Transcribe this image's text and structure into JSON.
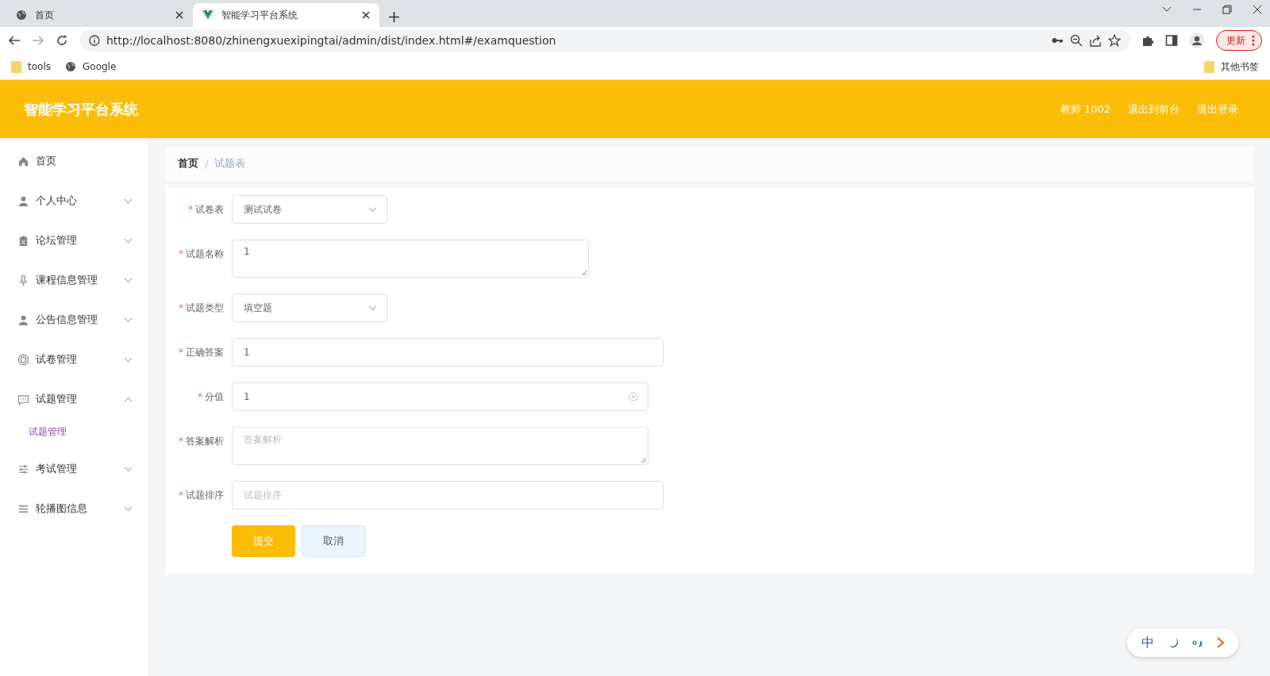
{
  "browser": {
    "tabs": [
      {
        "title": "首页",
        "selected": false
      },
      {
        "title": "智能学习平台系统",
        "selected": true
      }
    ],
    "url": "http://localhost:8080/zhinengxuexipingtai/admin/dist/index.html#/examquestion",
    "update_button": "更新",
    "bookmarks": [
      "tools",
      "Google"
    ],
    "other_bookmarks": "其他书签"
  },
  "header": {
    "title": "智能学习平台系统",
    "links": [
      "教师 1002",
      "退出到前台",
      "退出登录"
    ]
  },
  "sidebar": {
    "items": [
      {
        "label": "首页",
        "kind": "link"
      },
      {
        "label": "个人中心",
        "kind": "menu",
        "expanded": false
      },
      {
        "label": "论坛管理",
        "kind": "menu",
        "expanded": false
      },
      {
        "label": "课程信息管理",
        "kind": "menu",
        "expanded": false
      },
      {
        "label": "公告信息管理",
        "kind": "menu",
        "expanded": false
      },
      {
        "label": "试卷管理",
        "kind": "menu",
        "expanded": false
      },
      {
        "label": "试题管理",
        "kind": "menu",
        "expanded": true,
        "children": [
          {
            "label": "试题管理",
            "selected": true
          }
        ]
      },
      {
        "label": "考试管理",
        "kind": "menu",
        "expanded": false
      },
      {
        "label": "轮播图信息",
        "kind": "menu",
        "expanded": false
      }
    ]
  },
  "breadcrumb": [
    "首页",
    "试题表"
  ],
  "breadcrumb_separator": "/",
  "form": {
    "fields": [
      {
        "required_mark": "*",
        "label": "试卷表",
        "kind": "select",
        "value": "测试试卷"
      },
      {
        "required_mark": "*",
        "label": "试题名称",
        "kind": "textarea",
        "value": "1"
      },
      {
        "required_mark": "*",
        "label": "试题类型",
        "kind": "select",
        "value": "填空题"
      },
      {
        "required_mark": "*",
        "label": "正确答案",
        "kind": "input",
        "value": "1"
      },
      {
        "required_mark": "*",
        "label": "分值",
        "kind": "clearable",
        "value": "1"
      },
      {
        "required_mark": "*",
        "label": "答案解析",
        "kind": "textarea",
        "placeholder": "答案解析"
      },
      {
        "required_mark": "*",
        "label": "试题排序",
        "kind": "input",
        "placeholder": "试题排序"
      }
    ],
    "buttons": [
      "提交",
      "取消"
    ]
  },
  "ime": {
    "mode": "中"
  }
}
